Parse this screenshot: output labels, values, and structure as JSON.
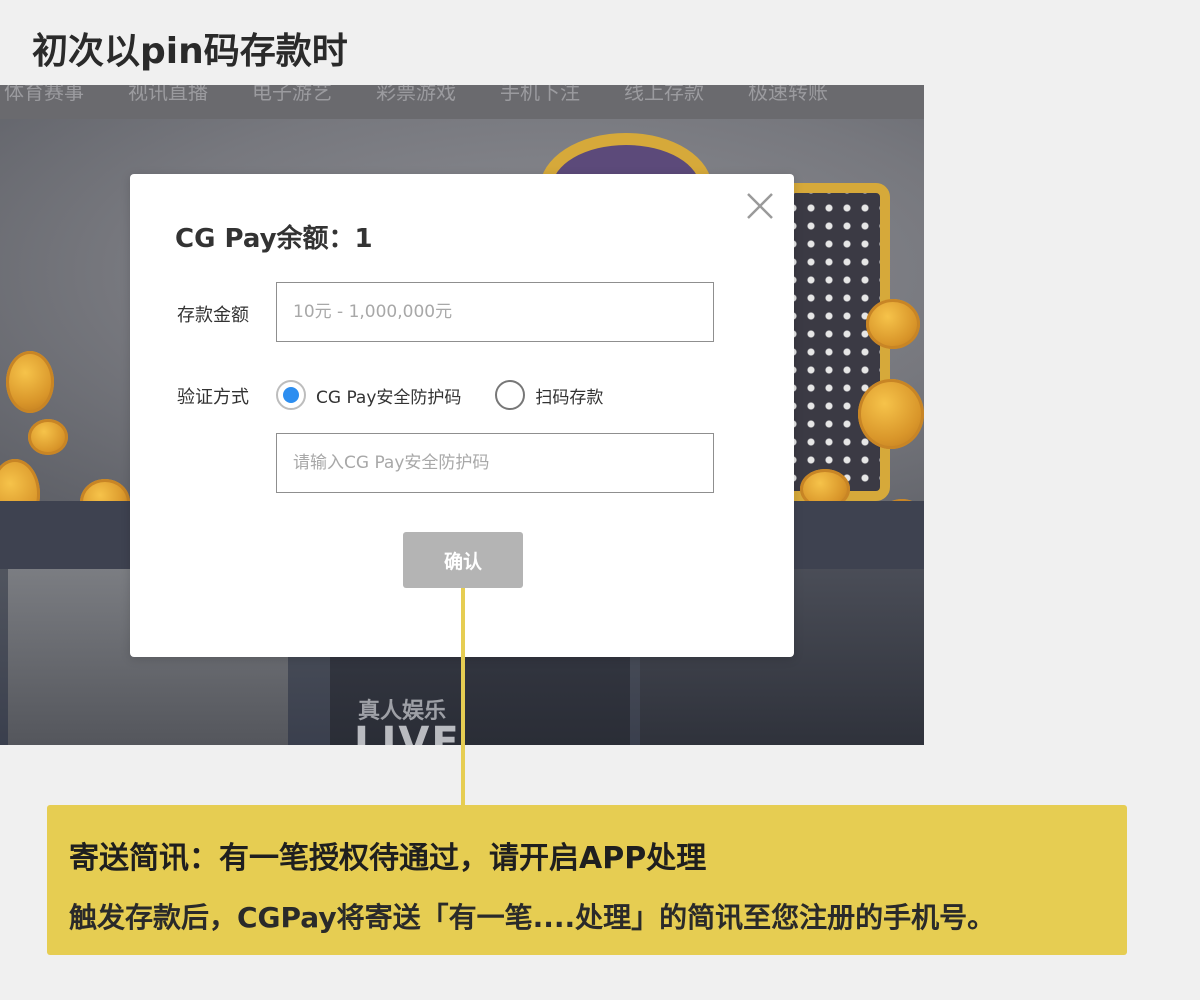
{
  "heading": "初次以pin码存款时",
  "background_site": {
    "nav_items": [
      "体育赛事",
      "视讯直播",
      "电子游艺",
      "彩票游戏",
      "手机下注",
      "线上存款",
      "极速转账"
    ],
    "thumb_text": "真人娱乐",
    "thumb_live": "LIVE"
  },
  "modal": {
    "title": "CG Pay余额：1",
    "amount_label": "存款金额",
    "amount_placeholder": "10元 - 1,000,000元",
    "verify_label": "验证方式",
    "radio_options": [
      {
        "label": "CG Pay安全防护码",
        "checked": true
      },
      {
        "label": "扫码存款",
        "checked": false
      }
    ],
    "pin_placeholder": "请输入CG Pay安全防护码",
    "confirm_label": "确认"
  },
  "callout": {
    "title": "寄送简讯：有一笔授权待通过，请开启APP处理",
    "description": "触发存款后，CGPay将寄送「有一笔....处理」的简讯至您注册的手机号。"
  },
  "colors": {
    "accent_yellow": "#e6cd52",
    "radio_blue": "#2d8ef0",
    "button_gray": "#b4b4b4"
  }
}
